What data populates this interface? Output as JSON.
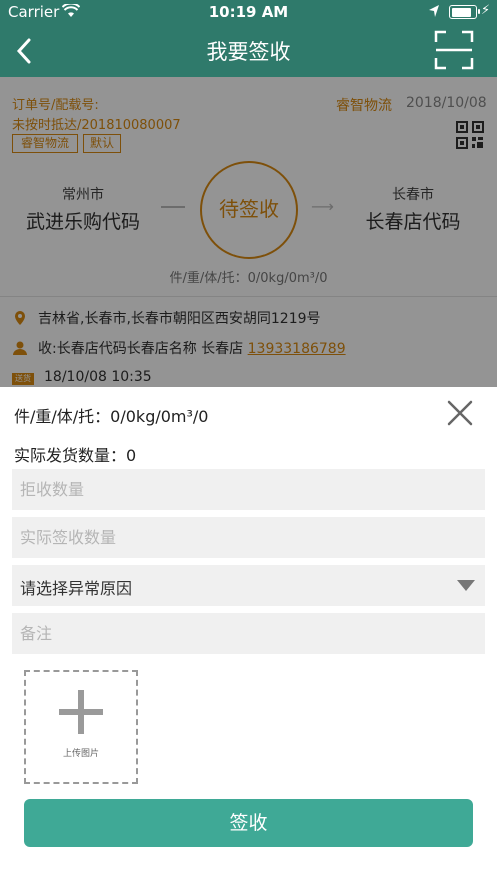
{
  "status_bar": {
    "carrier": "Carrier",
    "time": "10:19 AM"
  },
  "nav": {
    "title": "我要签收"
  },
  "order": {
    "label": "订单号/配载号:",
    "number": "未按时抵达/201810080007",
    "tags": [
      "睿智物流",
      "默认"
    ],
    "carrier_name": "睿智物流",
    "date": "2018/10/08"
  },
  "route": {
    "from_city": "常州市",
    "from_name": "武进乐购代码",
    "status": "待签收",
    "to_city": "长春市",
    "to_name": "长春店代码",
    "weight_line": "件/重/体/托：0/0kg/0m³/0"
  },
  "details": {
    "address": "吉林省,长春市,长春市朝阳区西安胡同1219号",
    "receiver_prefix": "收:长春店代码长春店名称 长春店 ",
    "phone": "13933186789",
    "badge": "送货",
    "datetime": "18/10/08 10:35"
  },
  "sheet": {
    "weight_line": "件/重/体/托：0/0kg/0m³/0",
    "actual_count": "实际发货数量：0",
    "reject_placeholder": "拒收数量",
    "actual_sign_placeholder": "实际签收数量",
    "reason_select": "请选择异常原因",
    "remark_placeholder": "备注",
    "upload_label": "上传图片",
    "submit_label": "签收"
  },
  "colors": {
    "primary": "#2f7a6b",
    "accent": "#d98a12",
    "button": "#3fa996"
  },
  "icons": [
    "wifi-icon",
    "location-arrow-icon",
    "battery-icon",
    "back-icon",
    "scan-icon",
    "qr-code-icon",
    "location-pin-icon",
    "person-icon",
    "close-icon",
    "dropdown-caret-icon",
    "plus-icon"
  ]
}
